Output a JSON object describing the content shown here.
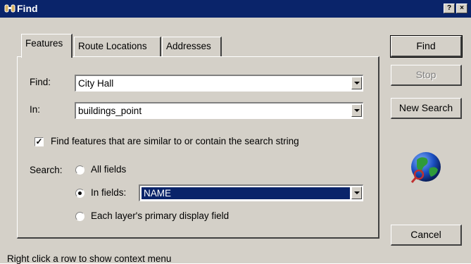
{
  "window": {
    "title": "Find",
    "help_button": "?",
    "close_button": "×"
  },
  "tabs": [
    {
      "label": "Features",
      "active": true
    },
    {
      "label": "Route Locations",
      "active": false
    },
    {
      "label": "Addresses",
      "active": false
    }
  ],
  "form": {
    "find_label": "Find:",
    "find_value": "City Hall",
    "in_label": "In:",
    "in_value": "buildings_point",
    "similar_checkbox_label": "Find features that are similar to or contain the search string",
    "similar_checked": true,
    "search_label": "Search:",
    "options": {
      "all_fields": "All fields",
      "in_fields": "In fields:",
      "primary_field": "Each layer's primary display field"
    },
    "selected_option": "in_fields",
    "in_fields_value": "NAME"
  },
  "buttons": {
    "find": "Find",
    "stop": "Stop",
    "new_search": "New Search",
    "cancel": "Cancel"
  },
  "status_text": "Right click a row to show context menu",
  "colors": {
    "titlebar": "#0a246a",
    "dialog_bg": "#d4d0c8",
    "selection": "#0a246a"
  },
  "icons": [
    "binoculars-icon",
    "globe-magnifier-icon"
  ]
}
